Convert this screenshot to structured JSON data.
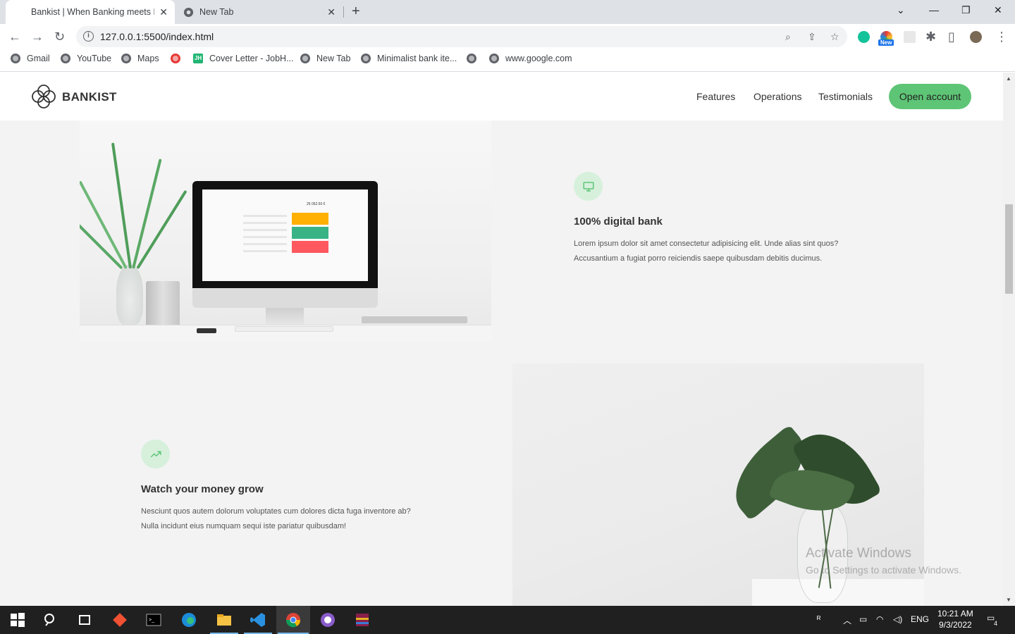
{
  "browser": {
    "tabs": [
      {
        "title": "Bankist | When Banking meets Minimalist",
        "active": true
      },
      {
        "title": "New Tab",
        "active": false
      }
    ],
    "url": "127.0.0.1:5500/index.html",
    "bookmarks": [
      "Gmail",
      "YouTube",
      "Maps",
      "",
      "Cover Letter - JobH...",
      "New Tab",
      "Minimalist bank ite...",
      "",
      "www.google.com"
    ],
    "ext_badge": "New"
  },
  "site": {
    "logo": "BANKIST",
    "nav": [
      "Features",
      "Operations",
      "Testimonials"
    ],
    "cta": "Open account",
    "accent": "#5ec576",
    "features": [
      {
        "icon": "monitor-icon",
        "title": "100% digital bank",
        "text_l1": "Lorem ipsum dolor sit amet consectetur adipisicing elit. Unde alias sint quos?",
        "text_l2": "Accusantium a fugiat porro reiciendis saepe quibusdam debitis ducimus."
      },
      {
        "icon": "trending-up-icon",
        "title": "Watch your money grow",
        "text_l1": "Nesciunt quos autem dolorum voluptates cum dolores dicta fuga inventore ab?",
        "text_l2": "Nulla incidunt eius numquam sequi iste pariatur quibusdam!"
      }
    ],
    "monitor_balance": "25 052.50 €"
  },
  "watermark": {
    "title": "Activate Windows",
    "subtitle": "Go to Settings to activate Windows."
  },
  "taskbar": {
    "language": "ENG",
    "time": "10:21 AM",
    "date": "9/3/2022",
    "notifications": "4"
  }
}
